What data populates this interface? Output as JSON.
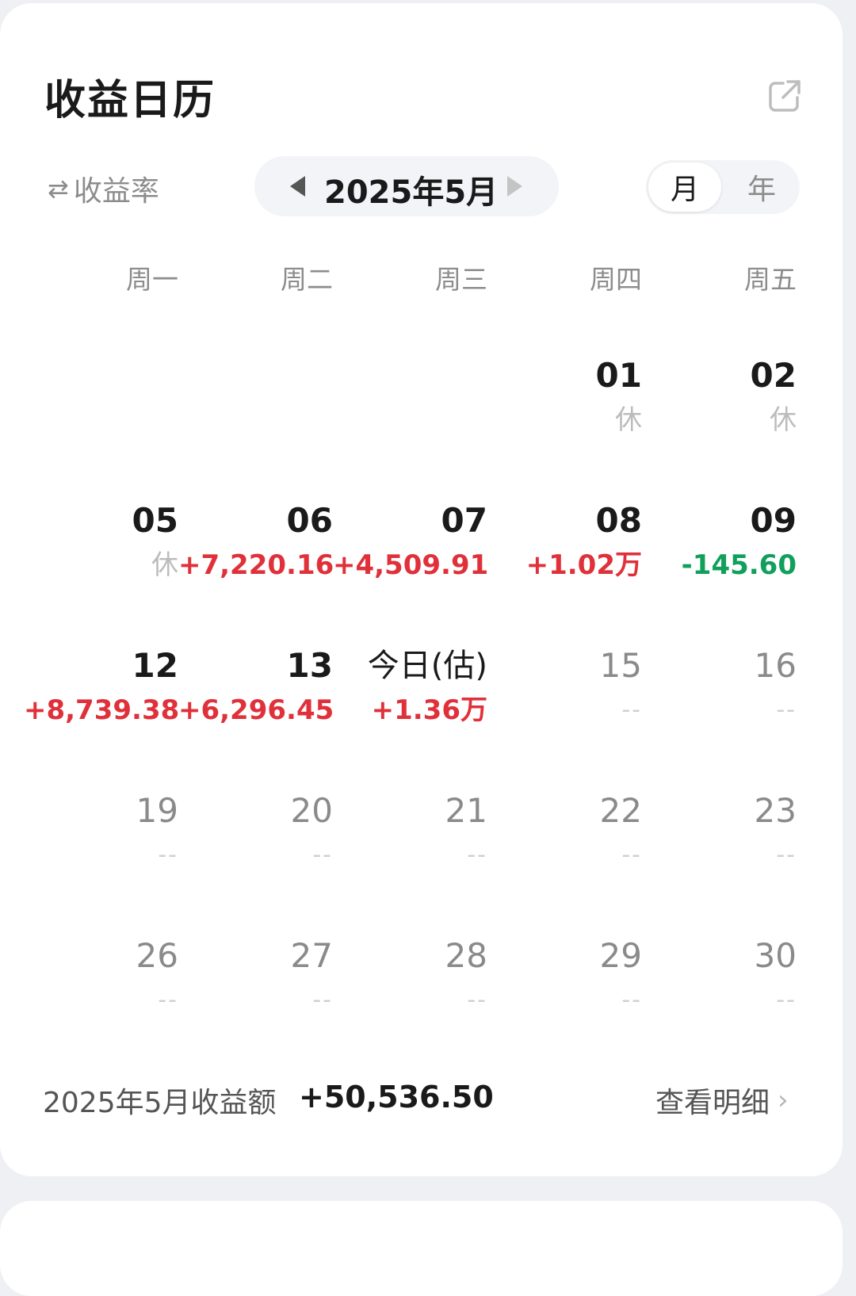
{
  "header": {
    "title": "收益日历"
  },
  "controls": {
    "metric_toggle": "收益率",
    "month": "2025年5月",
    "view_month": "月",
    "view_year": "年"
  },
  "weekdays": [
    "周一",
    "周二",
    "周三",
    "周四",
    "周五"
  ],
  "calendar": {
    "rows": [
      [
        {
          "day": "",
          "value": "",
          "kind": "empty"
        },
        {
          "day": "",
          "value": "",
          "kind": "empty"
        },
        {
          "day": "",
          "value": "",
          "kind": "empty"
        },
        {
          "day": "01",
          "value": "休",
          "kind": "rest"
        },
        {
          "day": "02",
          "value": "休",
          "kind": "rest"
        }
      ],
      [
        {
          "day": "05",
          "value": "休",
          "kind": "rest"
        },
        {
          "day": "06",
          "value": "+7,220.16",
          "kind": "pos"
        },
        {
          "day": "07",
          "value": "+4,509.91",
          "kind": "pos"
        },
        {
          "day": "08",
          "value": "+1.02万",
          "kind": "pos"
        },
        {
          "day": "09",
          "value": "-145.60",
          "kind": "neg"
        }
      ],
      [
        {
          "day": "12",
          "value": "+8,739.38",
          "kind": "pos"
        },
        {
          "day": "13",
          "value": "+6,296.45",
          "kind": "pos"
        },
        {
          "day": "今日(估)",
          "value": "+1.36万",
          "kind": "today"
        },
        {
          "day": "15",
          "value": "--",
          "kind": "future"
        },
        {
          "day": "16",
          "value": "--",
          "kind": "future"
        }
      ],
      [
        {
          "day": "19",
          "value": "--",
          "kind": "future"
        },
        {
          "day": "20",
          "value": "--",
          "kind": "future"
        },
        {
          "day": "21",
          "value": "--",
          "kind": "future"
        },
        {
          "day": "22",
          "value": "--",
          "kind": "future"
        },
        {
          "day": "23",
          "value": "--",
          "kind": "future"
        }
      ],
      [
        {
          "day": "26",
          "value": "--",
          "kind": "future"
        },
        {
          "day": "27",
          "value": "--",
          "kind": "future"
        },
        {
          "day": "28",
          "value": "--",
          "kind": "future"
        },
        {
          "day": "29",
          "value": "--",
          "kind": "future"
        },
        {
          "day": "30",
          "value": "--",
          "kind": "future"
        }
      ]
    ]
  },
  "summary": {
    "label": "2025年5月收益额",
    "value": "+50,536.50",
    "detail_link": "查看明细"
  },
  "colors": {
    "positive": "#e0313b",
    "negative": "#11a05c",
    "muted": "#8c8c8c"
  },
  "icons": {
    "share": "share-icon",
    "swap": "swap-icon",
    "prev": "prev-triangle-icon",
    "next": "next-triangle-icon",
    "chevron": "chevron-right-icon"
  }
}
